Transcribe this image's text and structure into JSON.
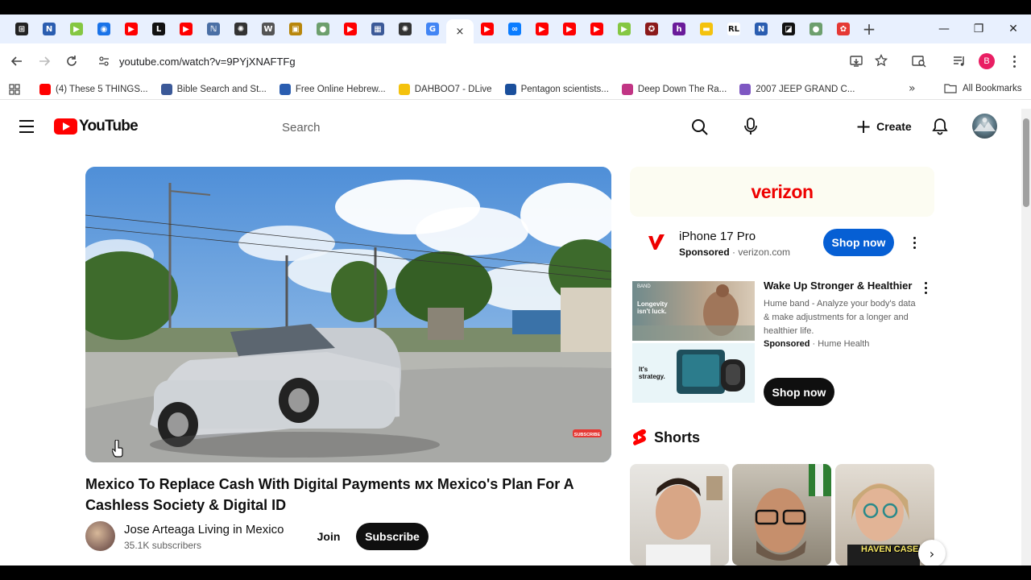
{
  "browser": {
    "url": "youtube.com/watch?v=9PYjXNAFTFg",
    "new_tab": "+",
    "tab_close": "×",
    "tabs": [
      {
        "icon": "grid-favicon-icon",
        "color": "#222222",
        "glyph": "⊞"
      },
      {
        "icon": "n-favicon-icon",
        "color": "#2a5db0",
        "glyph": "N"
      },
      {
        "icon": "rumble-favicon-icon",
        "color": "#85c742",
        "glyph": "▶"
      },
      {
        "icon": "globe-favicon-icon",
        "color": "#1a73e8",
        "glyph": "◉"
      },
      {
        "icon": "youtube-favicon-icon",
        "color": "#ff0000",
        "glyph": "▶"
      },
      {
        "icon": "l-favicon-icon",
        "color": "#111111",
        "glyph": "L"
      },
      {
        "icon": "youtube-favicon-icon",
        "color": "#ff0000",
        "glyph": "▶"
      },
      {
        "icon": "script-favicon-icon",
        "color": "#4a6fa5",
        "glyph": "ℕ"
      },
      {
        "icon": "openai-favicon-icon",
        "color": "#333333",
        "glyph": "✺"
      },
      {
        "icon": "wikipedia-favicon-icon",
        "color": "#555555",
        "glyph": "W"
      },
      {
        "icon": "book-favicon-icon",
        "color": "#b8860b",
        "glyph": "▣"
      },
      {
        "icon": "avatar-favicon-icon",
        "color": "#6d9f6d",
        "glyph": "●"
      },
      {
        "icon": "youtube-favicon-icon",
        "color": "#ff0000",
        "glyph": "▶"
      },
      {
        "icon": "user-favicon-icon",
        "color": "#3b5998",
        "glyph": "▦"
      },
      {
        "icon": "openai-favicon-icon",
        "color": "#333333",
        "glyph": "✺"
      },
      {
        "icon": "google-favicon-icon",
        "color": "#4285f4",
        "glyph": "G"
      },
      {
        "icon": "close-tab-icon",
        "color": "#ffffff",
        "glyph": "×"
      },
      {
        "icon": "youtube-favicon-icon",
        "color": "#ff0000",
        "glyph": "▶"
      },
      {
        "icon": "messenger-favicon-icon",
        "color": "#0a7cff",
        "glyph": "∞"
      },
      {
        "icon": "youtube-favicon-icon",
        "color": "#ff0000",
        "glyph": "▶"
      },
      {
        "icon": "youtube-favicon-icon",
        "color": "#ff0000",
        "glyph": "▶"
      },
      {
        "icon": "youtube-favicon-icon",
        "color": "#ff0000",
        "glyph": "▶"
      },
      {
        "icon": "rumble-favicon-icon",
        "color": "#85c742",
        "glyph": "▶"
      },
      {
        "icon": "shield-favicon-icon",
        "color": "#8b1a1a",
        "glyph": "✪"
      },
      {
        "icon": "h-favicon-icon",
        "color": "#6a1b9a",
        "glyph": "h"
      },
      {
        "icon": "yellow-favicon-icon",
        "color": "#f4c20d",
        "glyph": "▬"
      },
      {
        "icon": "rl-favicon-icon",
        "color": "#ffffff",
        "glyph": "RL"
      },
      {
        "icon": "n-favicon-icon",
        "color": "#2a5db0",
        "glyph": "N"
      },
      {
        "icon": "dark-favicon-icon",
        "color": "#111111",
        "glyph": "◪"
      },
      {
        "icon": "avatar-favicon-icon",
        "color": "#6d9f6d",
        "glyph": "●"
      },
      {
        "icon": "flower-favicon-icon",
        "color": "#e53935",
        "glyph": "✿"
      }
    ],
    "window": {
      "minimize": "—",
      "restore": "❐",
      "close": "✕"
    },
    "profile_letter": "B",
    "bookmarks": [
      {
        "label": "(4) These 5 THINGS...",
        "color": "#ff0000"
      },
      {
        "label": "Bible Search and St...",
        "color": "#3b5998"
      },
      {
        "label": "Free Online Hebrew...",
        "color": "#2a5db0"
      },
      {
        "label": "DAHBOO7 - DLive",
        "color": "#f4c20d"
      },
      {
        "label": "Pentagon scientists...",
        "color": "#1a4f9c"
      },
      {
        "label": "Deep Down The Ra...",
        "color": "#c13584"
      },
      {
        "label": "2007 JEEP GRAND C...",
        "color": "#7e57c2"
      }
    ],
    "bookmarks_more": "»",
    "all_bookmarks": "All Bookmarks"
  },
  "youtube": {
    "logo_text": "YouTube",
    "search_placeholder": "Search",
    "create_label": "Create",
    "video": {
      "title": "Mexico To Replace Cash With Digital Payments 🇲🇽 Mexico's Plan For A Cashless Society & Digital ID",
      "title_display": "Mexico To Replace Cash With Digital Payments ᴍx Mexico's Plan For A Cashless Society & Digital ID",
      "channel": "Jose Arteaga Living in Mexico",
      "subscribers": "35.1K subscribers",
      "join_label": "Join",
      "subscribe_label": "Subscribe",
      "overlay_badge": "SUBSCRIBE"
    },
    "ads": {
      "banner_brand": "verizon",
      "ad1": {
        "title": "iPhone 17 Pro",
        "sponsored": "Sponsored",
        "domain": "verizon.com",
        "cta": "Shop now",
        "brand_color": "#ee0000"
      },
      "ad2": {
        "title": "Wake Up Stronger & Healthier",
        "description": "Hume band - Analyze your body's data & make adjustments for a longer and healthier life.",
        "sponsored": "Sponsored",
        "advertiser": "Hume Health",
        "cta": "Shop now",
        "img_top_brand": "BAND",
        "img_top_text": "Longevity isn't luck.",
        "img_bot_text": "It's strategy."
      }
    },
    "shorts": {
      "heading": "Shorts",
      "short3_caption": "HAVEN CASE"
    }
  }
}
